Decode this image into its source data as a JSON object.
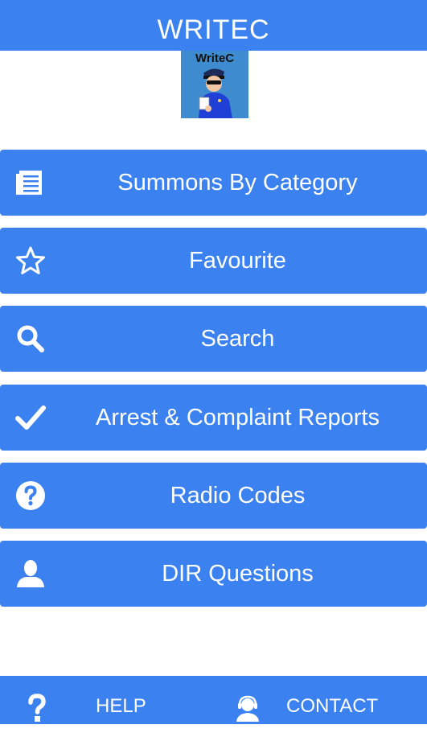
{
  "app_bar": {
    "title": "WRITEC"
  },
  "logo": {
    "text": "WriteC"
  },
  "menu": [
    {
      "label": "Summons By Category",
      "icon": "document-list-icon"
    },
    {
      "label": "Favourite",
      "icon": "star-icon"
    },
    {
      "label": "Search",
      "icon": "search-icon"
    },
    {
      "label": "Arrest & Complaint Reports",
      "icon": "checkmark-icon"
    },
    {
      "label": "Radio Codes",
      "icon": "question-circle-icon"
    },
    {
      "label": "DIR Questions",
      "icon": "person-icon"
    }
  ],
  "bottom_bar": {
    "help_label": "HELP",
    "contact_label": "CONTACT"
  },
  "colors": {
    "primary": "#3b82f0",
    "on_primary": "#ffffff",
    "background": "#ffffff"
  }
}
